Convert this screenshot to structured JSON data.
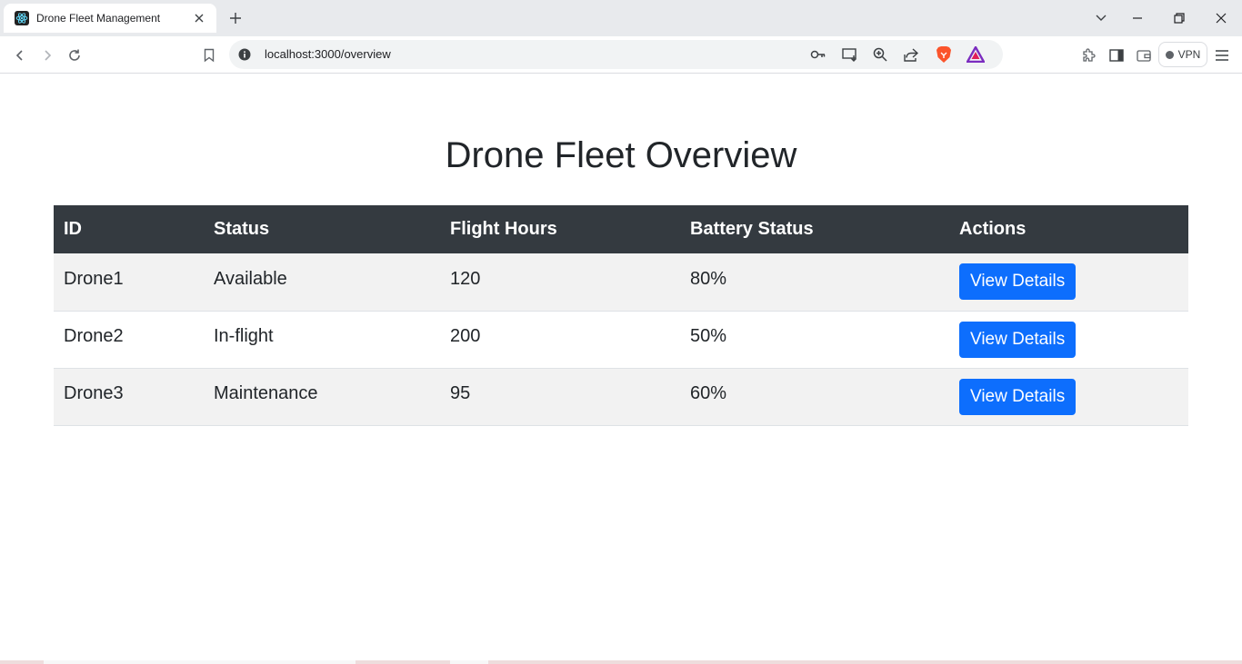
{
  "browser": {
    "tab_title": "Drone Fleet Management",
    "url": "localhost:3000/overview",
    "vpn_label": "VPN",
    "icons": {
      "tab_favicon": "react-atom-icon",
      "tab_close": "close-icon",
      "new_tab": "plus-icon",
      "tab_search": "chevron-down-icon",
      "minimize": "minimize-icon",
      "restore": "restore-icon",
      "close_window": "close-window-icon",
      "back": "back-arrow-icon",
      "forward": "forward-arrow-icon",
      "reload": "reload-icon",
      "bookmark": "bookmark-icon",
      "site_info": "info-icon",
      "password": "key-icon",
      "install": "install-app-icon",
      "zoom": "zoom-in-icon",
      "share": "share-icon",
      "brave": "brave-lion-icon",
      "rewards": "rewards-triangle-icon",
      "extensions": "puzzle-icon",
      "sidebar": "sidebar-icon",
      "wallet": "wallet-icon",
      "menu": "hamburger-menu-icon"
    }
  },
  "page": {
    "title": "Drone Fleet Overview",
    "table": {
      "headers": [
        "ID",
        "Status",
        "Flight Hours",
        "Battery Status",
        "Actions"
      ],
      "rows": [
        {
          "id": "Drone1",
          "status": "Available",
          "flight_hours": "120",
          "battery": "80%",
          "action_label": "View Details"
        },
        {
          "id": "Drone2",
          "status": "In-flight",
          "flight_hours": "200",
          "battery": "50%",
          "action_label": "View Details"
        },
        {
          "id": "Drone3",
          "status": "Maintenance",
          "flight_hours": "95",
          "battery": "60%",
          "action_label": "View Details"
        }
      ]
    }
  },
  "colors": {
    "header_bg": "#343a40",
    "primary_button": "#0d6efd",
    "striped_row": "#f2f2f2",
    "text": "#212529"
  }
}
